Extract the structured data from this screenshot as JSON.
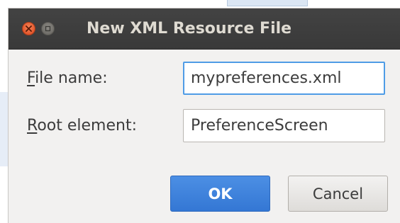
{
  "dialog": {
    "title": "New XML Resource File",
    "window_buttons": [
      {
        "icon": "close-icon",
        "color": "#e2562b"
      },
      {
        "icon": "minimize-icon",
        "color": "#6d6b66"
      }
    ]
  },
  "form": {
    "file_name": {
      "label_mnemonic": "F",
      "label_rest": "ile name:",
      "value": "mypreferences.xml"
    },
    "root_element": {
      "label_mnemonic": "R",
      "label_rest": "oot element:",
      "value": "PreferenceScreen"
    }
  },
  "buttons": {
    "ok_label": "OK",
    "cancel_label": "Cancel"
  },
  "colors": {
    "titlebar": "#3d3d3d",
    "accent": "#3f84dc",
    "dialog_bg": "#f2f1f0",
    "focus_ring": "#4f9ce6"
  }
}
